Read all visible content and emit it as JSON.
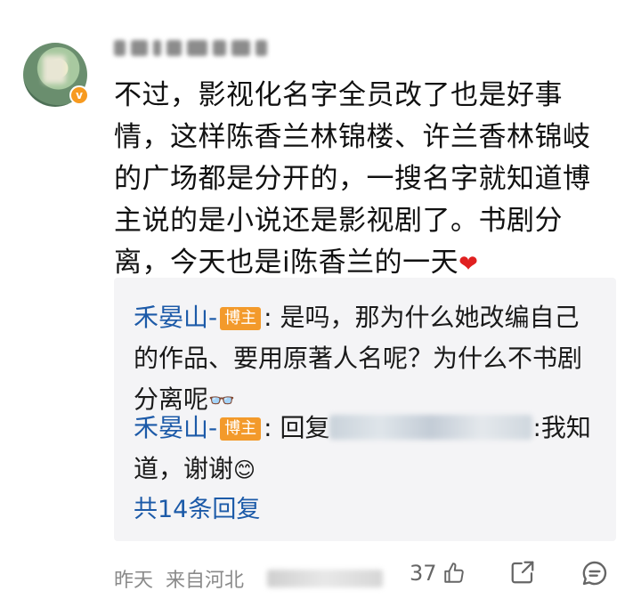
{
  "comment": {
    "text": "不过，影视化名字全员改了也是好事情，这样陈香兰林锦楼、许兰香林锦岐的广场都是分开的，一搜名字就知道博主说的是小说还是影视剧了。书剧分离，今天也是i陈香兰的一天",
    "verified_badge": "v"
  },
  "replies": [
    {
      "author": "禾晏山-",
      "tag": "博主",
      "text": ": 是吗，那为什么她改编自己的作品、要用原著人名呢？为什么不书剧分离呢"
    },
    {
      "author": "禾晏山-",
      "tag": "博主",
      "prefix": ": 回复",
      "suffix": ":我知道，谢谢"
    }
  ],
  "more_replies": "共14条回复",
  "meta": {
    "time": "昨天",
    "location": "来自河北"
  },
  "actions": {
    "like_count": "37"
  },
  "colors": {
    "link_blue": "#1c5aa8",
    "tag_orange": "#f39a2b",
    "reply_bg": "#f4f4f6",
    "meta_gray": "#8a8a8a"
  }
}
